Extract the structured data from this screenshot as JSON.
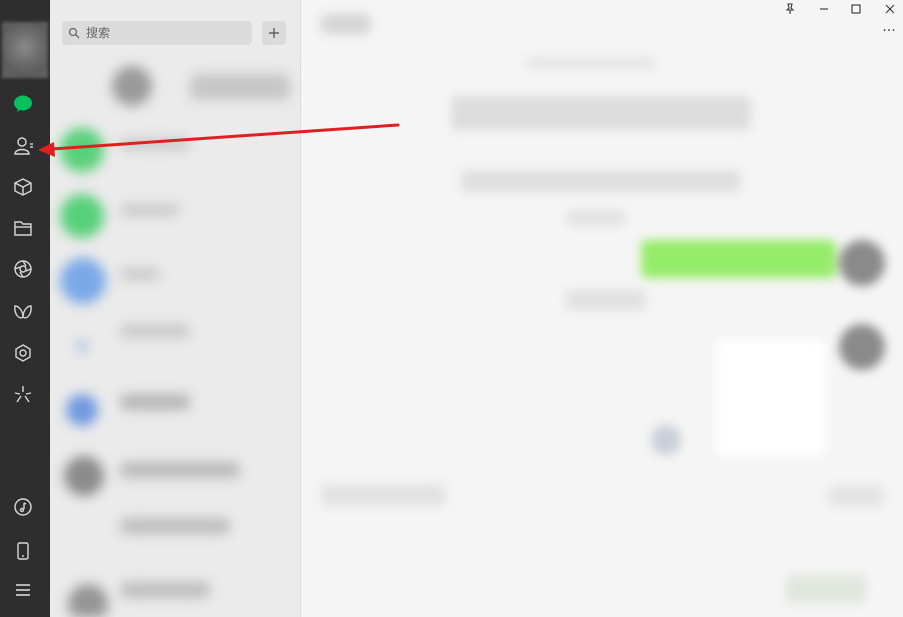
{
  "search": {
    "placeholder": "搜索"
  },
  "toolbar": {
    "add_label": "+",
    "more_label": "···"
  },
  "nav": {
    "items": [
      {
        "name": "chat",
        "icon": "chat-bubble-icon",
        "active": true
      },
      {
        "name": "contacts",
        "icon": "contacts-icon"
      },
      {
        "name": "favorites",
        "icon": "cube-icon"
      },
      {
        "name": "files",
        "icon": "folder-icon"
      },
      {
        "name": "moments",
        "icon": "aperture-icon"
      },
      {
        "name": "channels",
        "icon": "butterfly-icon"
      },
      {
        "name": "mini-programs",
        "icon": "hexagon-flower-icon"
      },
      {
        "name": "search-discover",
        "icon": "sparkle-icon"
      },
      {
        "name": "music",
        "icon": "music-disc-icon"
      },
      {
        "name": "phone",
        "icon": "phone-icon"
      },
      {
        "name": "menu",
        "icon": "menu-icon"
      }
    ]
  },
  "colors": {
    "sidebar": "#2e2e2e",
    "accent_green": "#07c160",
    "arrow_red": "#e02020",
    "bubble_green": "#95ec69"
  },
  "annotation": {
    "type": "red-arrow",
    "target": "contacts-icon"
  }
}
